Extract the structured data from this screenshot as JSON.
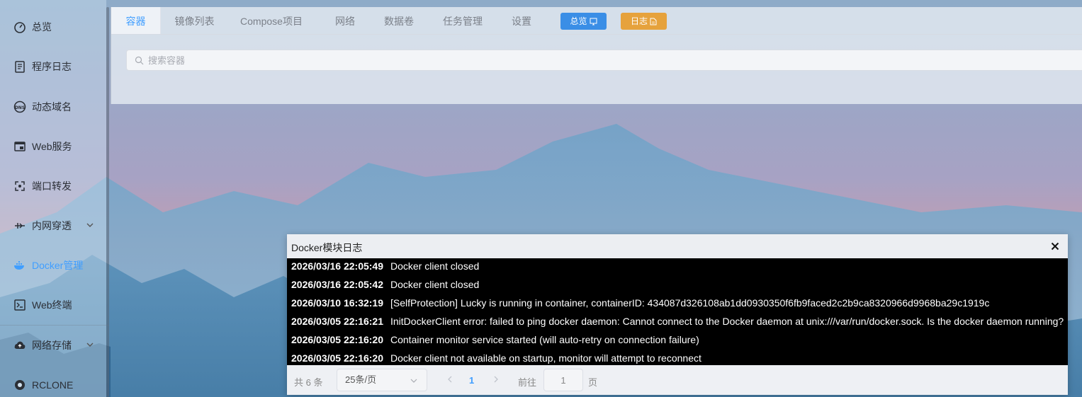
{
  "sidebar": {
    "items": [
      {
        "label": "总览",
        "icon": "dashboard-icon"
      },
      {
        "label": "程序日志",
        "icon": "log-icon"
      },
      {
        "label": "动态域名",
        "icon": "dns-icon"
      },
      {
        "label": "Web服务",
        "icon": "web-icon"
      },
      {
        "label": "端口转发",
        "icon": "port-forward-icon"
      },
      {
        "label": "内网穿透",
        "icon": "tunnel-icon"
      },
      {
        "label": "Docker管理",
        "icon": "docker-icon"
      },
      {
        "label": "Web终端",
        "icon": "terminal-icon"
      },
      {
        "label": "网络存储",
        "icon": "cloud-storage-icon"
      },
      {
        "label": "RCLONE",
        "icon": "rclone-icon"
      }
    ],
    "active": "Docker管理"
  },
  "tabs": [
    "容器",
    "镜像列表",
    "Compose项目",
    "网络",
    "数据卷",
    "任务管理",
    "设置"
  ],
  "active_tab": "容器",
  "buttons": {
    "overview": "总览",
    "log": "日志"
  },
  "search": {
    "placeholder": "搜索容器",
    "value": ""
  },
  "dialog": {
    "title": "Docker模块日志",
    "logs": [
      {
        "time": "2026/03/16 22:05:49",
        "msg": "Docker client closed"
      },
      {
        "time": "2026/03/16 22:05:42",
        "msg": "Docker client closed"
      },
      {
        "time": "2026/03/10 16:32:19",
        "msg": "[SelfProtection] Lucky is running in container, containerID: 434087d326108ab1dd0930350f6fb9faced2c2b9ca8320966d9968ba29c1919c"
      },
      {
        "time": "2026/03/05 22:16:21",
        "msg": "InitDockerClient error: failed to ping docker daemon: Cannot connect to the Docker daemon at unix:///var/run/docker.sock. Is the docker daemon running?"
      },
      {
        "time": "2026/03/05 22:16:20",
        "msg": "Container monitor service started (will auto-retry on connection failure)"
      },
      {
        "time": "2026/03/05 22:16:20",
        "msg": "Docker client not available on startup, monitor will attempt to reconnect"
      }
    ]
  },
  "pagination": {
    "total_text": "共 6 条",
    "page_size": "25条/页",
    "current_page": "1",
    "goto_label": "前往",
    "goto_value": "1",
    "page_unit": "页"
  },
  "colors": {
    "accent": "#409eff",
    "overview_btn": "#3a8ee6",
    "log_btn": "#e6a23c",
    "log_bg": "#000000"
  }
}
